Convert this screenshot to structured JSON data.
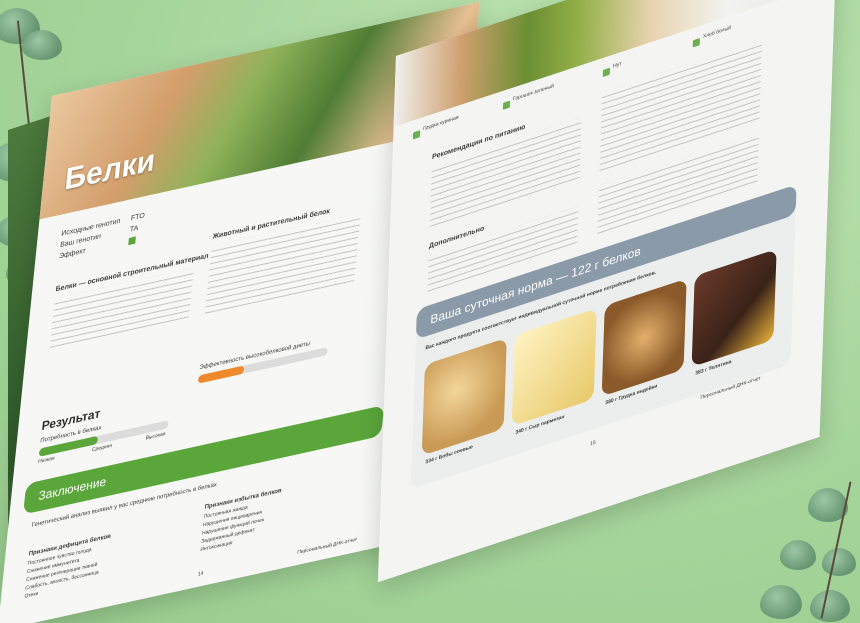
{
  "left_page": {
    "title": "Белки",
    "meta": [
      {
        "label": "Исходные генотип",
        "value": "FTO"
      },
      {
        "label": "Ваш генотип",
        "value": "TA"
      },
      {
        "label": "Эффект",
        "value": ""
      }
    ],
    "intro": "Белки — основной строительный материал",
    "intro_sub": "Животный и растительный белок",
    "result_title": "Результат",
    "need_label": "Потребность в белках",
    "efficiency_label": "Эффективность высокобелковой диеты",
    "need_value": 0.45,
    "efficiency_value": 0.35,
    "scale_low": "Низкая",
    "scale_mid": "Средняя",
    "scale_high": "Высокая",
    "conclusion_title": "Заключение",
    "conclusion_text": "Генетический анализ выявил у вас среднюю потребность в белках",
    "deficit_title": "Признаки дефицита белков",
    "deficit_items": [
      "Постоянное чувство голода",
      "Снижение иммунитета",
      "Снижение регенерации тканей",
      "Слабость, вялость, бессонница",
      "Отеки"
    ],
    "excess_title": "Признаки избытка белков",
    "excess_items": [
      "Постоянная жажда",
      "Нарушения пищеварения",
      "Нарушение функций почек",
      "Задержанный дефекат",
      "Интоксикация"
    ],
    "page_num": "14",
    "footer": "Персональный ДНК-отчет"
  },
  "right_page": {
    "top_labels": [
      "Грудка куриная",
      "Горошек зеленый",
      "Нут",
      "Хлеб белый"
    ],
    "rec_title": "Рекомендации по питанию",
    "add_title": "Дополнительно",
    "norm_title": "Ваша суточная норма — 122 г белков",
    "norm_sub": "Вас каждого продукта соответствует индивидуальной суточной норме потребления белков.",
    "foods": [
      {
        "label": "334 г Бобы соевые"
      },
      {
        "label": "340 г Сыр пармезан"
      },
      {
        "label": "380 г Грудка индейки"
      },
      {
        "label": "383 г Телятина"
      }
    ],
    "page_num": "15",
    "footer": "Персональный ДНК-отчет"
  },
  "colors": {
    "accent_green": "#5aa63b",
    "banner_grey": "#8b9aa8",
    "orange": "#ef8a2c"
  }
}
